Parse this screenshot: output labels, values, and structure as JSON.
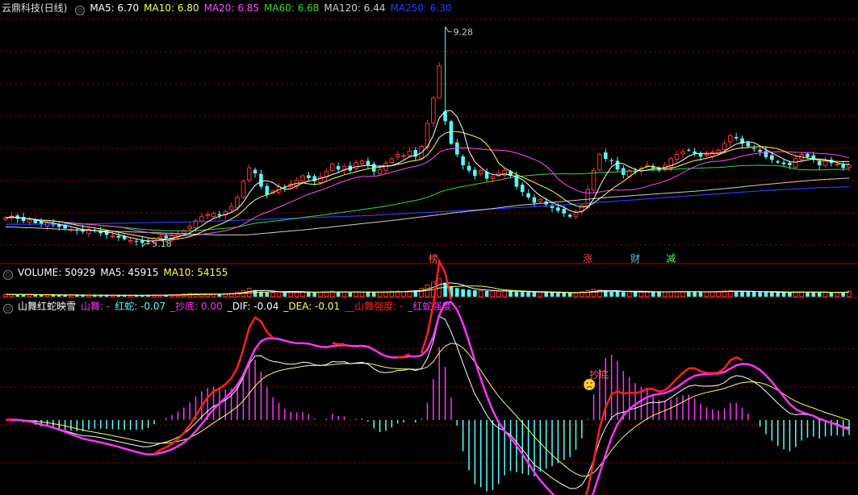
{
  "colors": {
    "up": "#ff3232",
    "down": "#54ffff",
    "ma5": "#ffffff",
    "ma10": "#ffff4d",
    "ma20": "#ff4dff",
    "ma60": "#33dd33",
    "ma120": "#cfcfcf",
    "ma250": "#2a3cff",
    "grid": "#8a0000",
    "sep": "#bb0000",
    "sw": "#ff2020",
    "hs": "#ff33ff",
    "tick_label": "#c8c8c8",
    "badge_bang": "#ff6060",
    "badge_zhang": "#ff4040",
    "badge_cai": "#4fc3ff",
    "badge_jian": "#4dff4d",
    "dif": "#ffffff",
    "dea": "#ffff66"
  },
  "header": {
    "stock": "云鼎科技(日线)",
    "ma5": "MA5: 6.70",
    "ma10": "MA10: 6.80",
    "ma20": "MA20: 6.85",
    "ma60": "MA60: 6.68",
    "ma120": "MA120: 6.44",
    "ma250": "MA250: 6.30"
  },
  "volume_header": {
    "volume": "VOLUME: 50929",
    "ma5": "MA5: 45915",
    "ma10": "MA10: 54155"
  },
  "indicator_header": {
    "name": "山舞红蛇映雪",
    "shanwu": "山舞: -",
    "hongshe": "红蛇: -0.07",
    "chaodi": "_抄底: 0.00",
    "dif": "_DIF: -0.04",
    "dea": "_DEA: -0.01",
    "sw_strength": "__山舞强度: -",
    "hs_strength": "_红蛇强度: -"
  },
  "annotations": {
    "high_label": "9.28",
    "low_label": "5.18",
    "chaodi_label": "抄底"
  },
  "badges": [
    {
      "text": "榜",
      "index": 72,
      "color": "badge_bang"
    },
    {
      "text": "涨",
      "index": 98,
      "color": "badge_zhang"
    },
    {
      "text": "财",
      "index": 106,
      "color": "badge_cai"
    },
    {
      "text": "减",
      "index": 112,
      "color": "badge_jian"
    }
  ],
  "chart_data": {
    "type": "candlestick",
    "title": "云鼎科技(日线)",
    "ylim": [
      5.0,
      9.45
    ],
    "high": {
      "index": 74,
      "value": 9.28
    },
    "low": {
      "index": 23,
      "value": 5.18
    },
    "close": [
      5.72,
      5.75,
      5.7,
      5.66,
      5.68,
      5.62,
      5.6,
      5.63,
      5.58,
      5.55,
      5.52,
      5.5,
      5.48,
      5.46,
      5.5,
      5.47,
      5.43,
      5.4,
      5.38,
      5.35,
      5.32,
      5.3,
      5.28,
      5.25,
      5.28,
      5.33,
      5.36,
      5.34,
      5.38,
      5.42,
      5.48,
      5.56,
      5.66,
      5.74,
      5.78,
      5.8,
      5.76,
      5.83,
      5.93,
      6.1,
      6.4,
      6.65,
      6.55,
      6.3,
      6.15,
      6.22,
      6.3,
      6.28,
      6.35,
      6.42,
      6.5,
      6.46,
      6.4,
      6.48,
      6.58,
      6.72,
      6.62,
      6.68,
      6.6,
      6.75,
      6.78,
      6.7,
      6.58,
      6.62,
      6.74,
      6.82,
      6.9,
      6.88,
      6.96,
      6.86,
      7.05,
      7.48,
      7.95,
      8.55,
      7.52,
      7.1,
      6.9,
      6.7,
      6.6,
      6.5,
      6.6,
      6.45,
      6.48,
      6.55,
      6.6,
      6.5,
      6.3,
      6.2,
      6.1,
      6.0,
      6.06,
      5.97,
      5.9,
      5.85,
      5.8,
      5.74,
      5.82,
      5.95,
      6.25,
      6.6,
      6.9,
      6.82,
      6.78,
      6.62,
      6.52,
      6.6,
      6.58,
      6.64,
      6.7,
      6.65,
      6.6,
      6.7,
      6.82,
      6.9,
      6.95,
      6.98,
      6.92,
      6.86,
      6.9,
      6.94,
      6.98,
      7.1,
      7.25,
      7.2,
      7.1,
      7.05,
      7.0,
      6.95,
      6.85,
      6.8,
      6.75,
      6.72,
      6.7,
      6.82,
      6.9,
      6.85,
      6.8,
      6.7,
      6.78,
      6.74,
      6.72,
      6.65,
      6.7
    ],
    "ma120": [
      5.55,
      5.53,
      5.5,
      5.48,
      5.46,
      5.44,
      5.42,
      5.4,
      5.4,
      5.45,
      5.5,
      5.56,
      5.62,
      5.68,
      5.75,
      5.82,
      5.88,
      5.95,
      6.0,
      6.05,
      6.1,
      6.14,
      6.18,
      6.22,
      6.27,
      6.33,
      6.38,
      6.43,
      6.46
    ],
    "ma250": [
      5.6,
      5.6,
      5.6,
      5.61,
      5.62,
      5.63,
      5.64,
      5.66,
      5.68,
      5.7,
      5.72,
      5.74,
      5.76,
      5.79,
      5.82,
      5.85,
      5.88,
      5.91,
      5.94,
      5.98,
      6.02,
      6.06,
      6.1,
      6.14,
      6.18,
      6.22,
      6.25,
      6.28,
      6.3
    ],
    "volume_ylim": [
      0,
      180000
    ],
    "volume": [
      22000,
      20000,
      18000,
      21000,
      19000,
      17000,
      16000,
      18000,
      15000,
      14000,
      16000,
      15000,
      14000,
      13000,
      15000,
      14000,
      13000,
      12000,
      14000,
      13000,
      12000,
      11000,
      13000,
      12000,
      14000,
      16000,
      15000,
      17000,
      18000,
      20000,
      24000,
      28000,
      26000,
      24000,
      22000,
      24000,
      26000,
      28000,
      32000,
      42000,
      58000,
      78000,
      62000,
      48000,
      40000,
      38000,
      42000,
      40000,
      38000,
      42000,
      46000,
      44000,
      40000,
      42000,
      46000,
      50000,
      44000,
      42000,
      40000,
      46000,
      44000,
      42000,
      40000,
      42000,
      46000,
      50000,
      52000,
      48000,
      54000,
      60000,
      78000,
      110000,
      135000,
      170000,
      130000,
      95000,
      80000,
      70000,
      64000,
      60000,
      58000,
      54000,
      52000,
      50000,
      54000,
      48000,
      46000,
      44000,
      42000,
      40000,
      42000,
      40000,
      38000,
      36000,
      36000,
      34000,
      38000,
      46000,
      56000,
      68000,
      62000,
      52000,
      48000,
      46000,
      44000,
      46000,
      44000,
      42000,
      46000,
      44000,
      42000,
      46000,
      48000,
      50000,
      48000,
      46000,
      44000,
      42000,
      44000,
      46000,
      50000,
      54000,
      56000,
      52000,
      48000,
      46000,
      44000,
      42000,
      40000,
      42000,
      40000,
      38000,
      40000,
      44000,
      46000,
      44000,
      42000,
      40000,
      42000,
      40000,
      38000,
      40000,
      50929
    ]
  }
}
